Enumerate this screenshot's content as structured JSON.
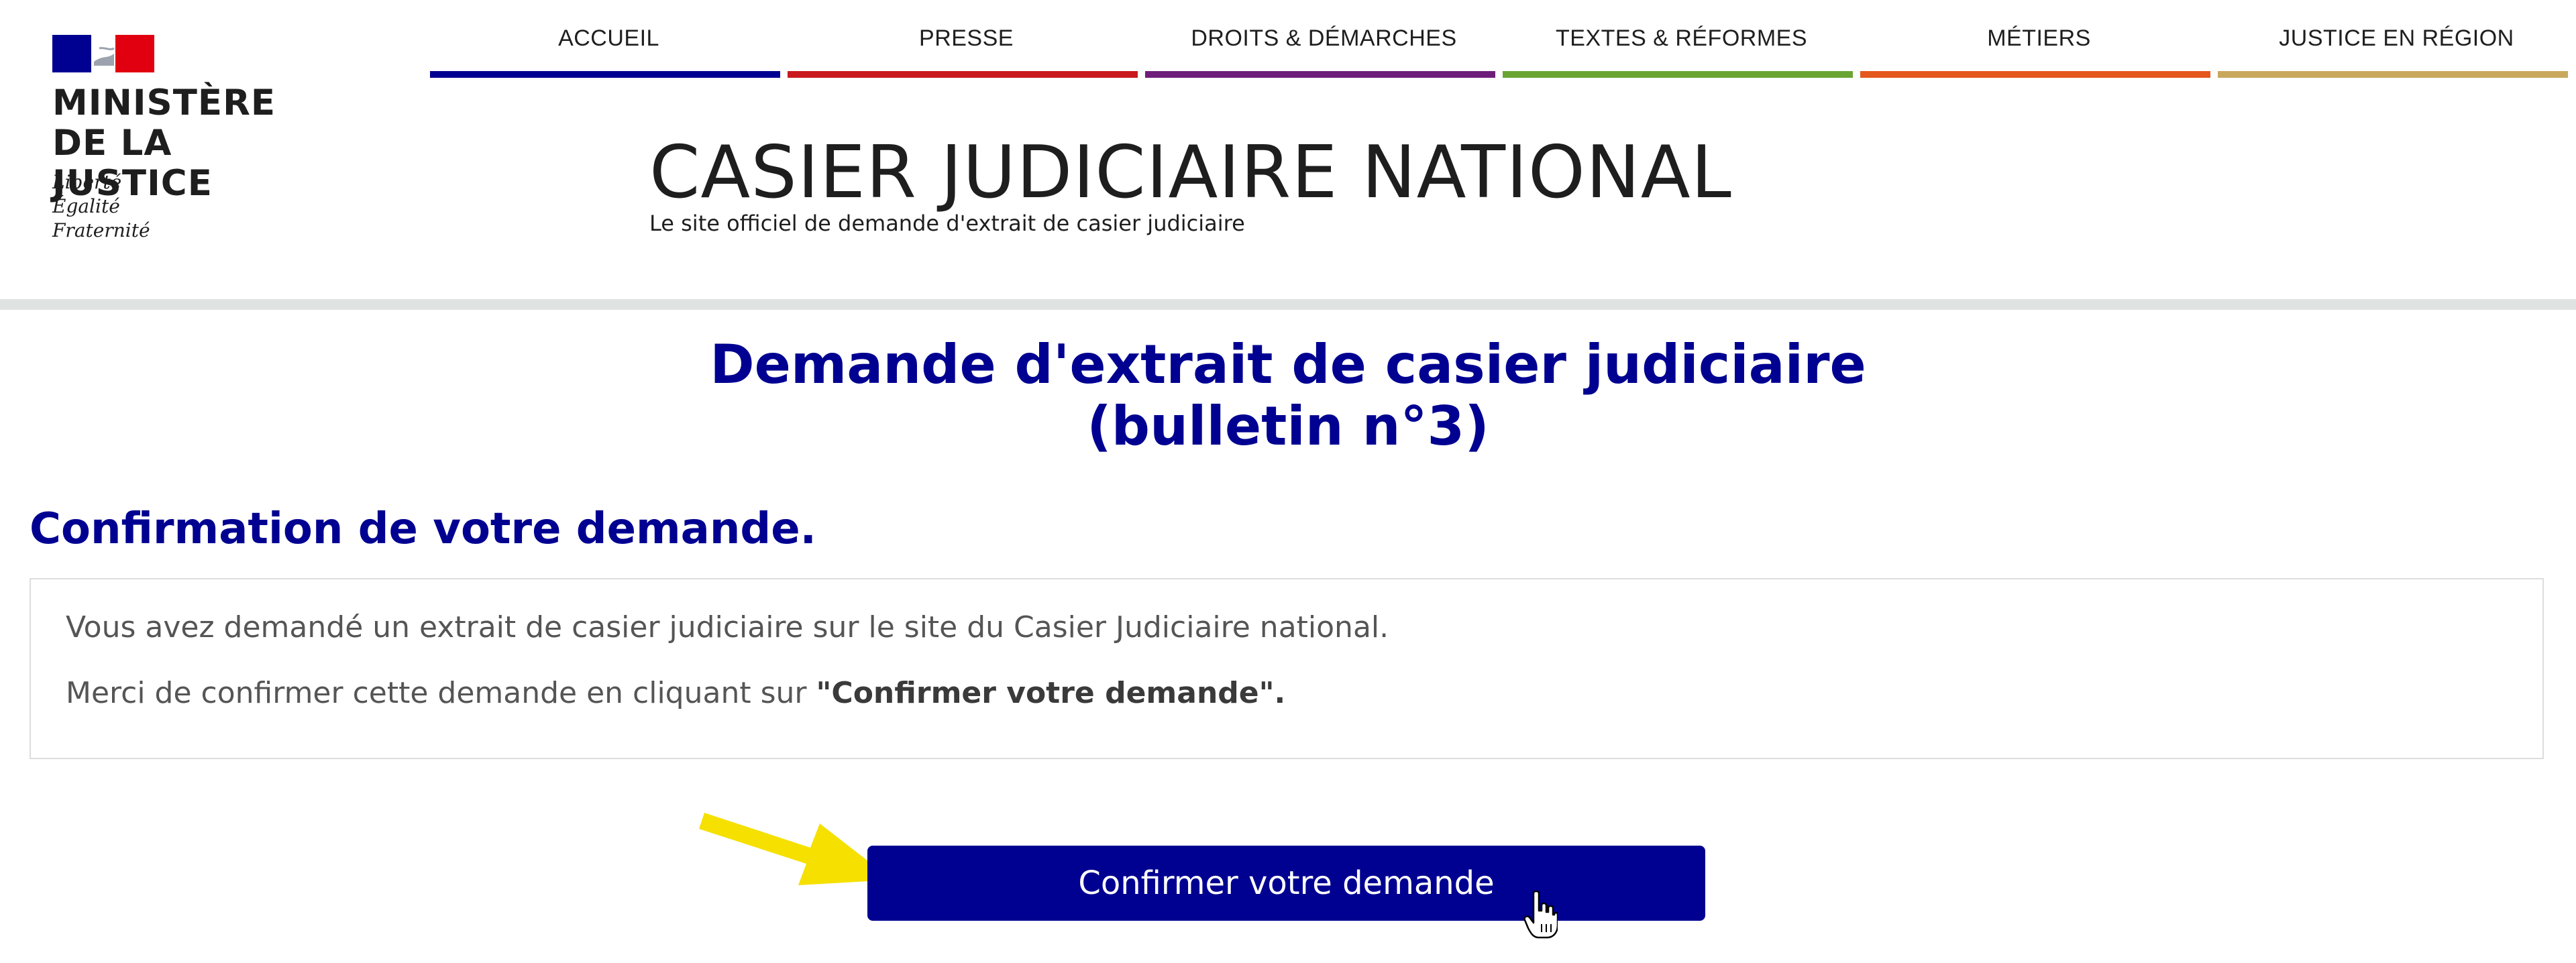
{
  "header": {
    "ministry_name": "MINISTÈRE\nDE LA JUSTICE",
    "motto": "Liberté\nÉgalité\nFraternité",
    "site_title": "CASIER JUDICIAIRE NATIONAL",
    "site_subtitle": "Le site officiel de demande d'extrait de casier judiciaire"
  },
  "nav": {
    "items": [
      {
        "label": "ACCUEIL",
        "color": "#000091"
      },
      {
        "label": "PRESSE",
        "color": "#c9191e"
      },
      {
        "label": "DROITS & DÉMARCHES",
        "color": "#6e1e7a"
      },
      {
        "label": "TEXTES & RÉFORMES",
        "color": "#68a532"
      },
      {
        "label": "MÉTIERS",
        "color": "#e4571f"
      },
      {
        "label": "JUSTICE EN RÉGION",
        "color": "#c8a85c"
      }
    ]
  },
  "main": {
    "page_title": "Demande d'extrait de casier judiciaire\n(bulletin n°3)",
    "section_title": "Confirmation de votre demande.",
    "info": {
      "line1": "Vous avez demandé un extrait de casier judiciaire sur le site du Casier Judiciaire national.",
      "line2_prefix": "Merci de confirmer cette demande en cliquant sur ",
      "line2_bold": "\"Confirmer votre demande\".",
      "line2_suffix": ""
    },
    "confirm_button": "Confirmer votre demande"
  },
  "colors": {
    "primary": "#000091",
    "header_rule": "#dfe3e1",
    "arrow": "#f5e000"
  },
  "icons": {
    "flag": "marianne-flag-icon",
    "arrow": "arrow-right-icon",
    "cursor": "hand-pointer-icon"
  }
}
